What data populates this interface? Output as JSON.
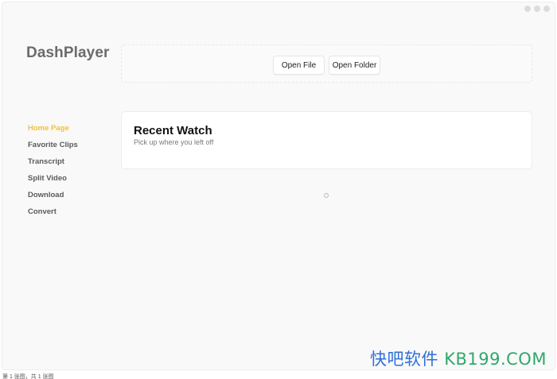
{
  "app": {
    "title": "DashPlayer"
  },
  "window_controls": [
    "dot-icon",
    "dot-icon",
    "dot-icon"
  ],
  "toolbar": {
    "open_file_label": "Open File",
    "open_folder_label": "Open Folder"
  },
  "sidebar": {
    "items": [
      {
        "label": "Home Page",
        "active": true
      },
      {
        "label": "Favorite Clips",
        "active": false
      },
      {
        "label": "Transcript",
        "active": false
      },
      {
        "label": "Split Video",
        "active": false
      },
      {
        "label": "Download",
        "active": false
      },
      {
        "label": "Convert",
        "active": false
      }
    ]
  },
  "recent_watch": {
    "title": "Recent Watch",
    "subtitle": "Pick up where you left off"
  },
  "watermark": {
    "part1": "快吧软件",
    "part2": "KB199.COM"
  },
  "footer": {
    "page_info": "第 1 张图，共 1 张图"
  },
  "colors": {
    "accent_active": "#f0c23a",
    "window_bg": "#f9f9f9"
  }
}
